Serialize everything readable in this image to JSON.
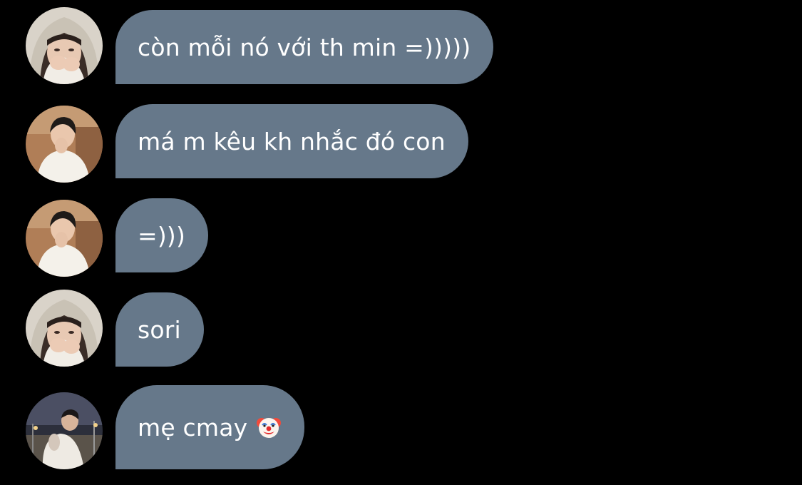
{
  "messages": [
    {
      "avatar": "hooded-user-avatar",
      "text": "còn mỗi nó với th min =)))))"
    },
    {
      "avatar": "white-shirt-user-avatar",
      "text": "má m kêu kh nhắc đó con"
    },
    {
      "avatar": "white-shirt-user-avatar",
      "text": "=)))"
    },
    {
      "avatar": "hooded-user-avatar",
      "text": "sori"
    },
    {
      "avatar": "night-street-user-avatar",
      "text": "mẹ cmay",
      "emoji": "clown-face-emoji"
    }
  ],
  "colors": {
    "background": "#000000",
    "bubble": "#66788a",
    "text": "#ffffff"
  }
}
